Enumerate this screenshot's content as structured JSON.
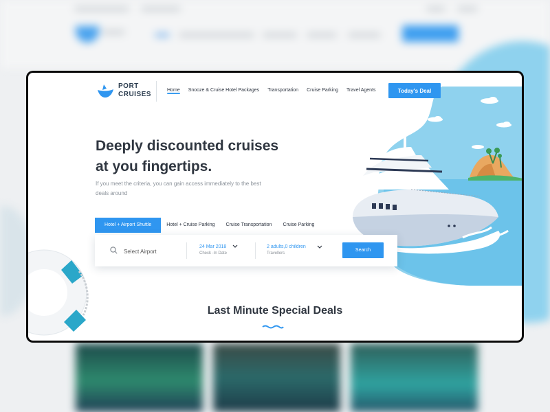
{
  "colors": {
    "accent": "#2f96f0",
    "text_dark": "#2f3640",
    "sea": "#8fd2ee"
  },
  "brand": {
    "line1": "PORT",
    "line2": "CRUISES",
    "logo_icon": "boat-icon"
  },
  "nav": {
    "items": [
      {
        "label": "Home",
        "active": true
      },
      {
        "label": "Snooze & Cruise Hotel Packages",
        "active": false
      },
      {
        "label": "Transportation",
        "active": false
      },
      {
        "label": "Cruise Parking",
        "active": false
      },
      {
        "label": "Travel Agents",
        "active": false
      }
    ],
    "cta_label": "Today's Deal"
  },
  "hero": {
    "title_line1": "Deeply discounted cruises",
    "title_line2": "at you fingertips.",
    "subtitle": "If you meet the criteria, you can gain access immediately to the best deals around"
  },
  "search": {
    "tabs": [
      {
        "label": "Hotel + Airport Shuttle",
        "active": true
      },
      {
        "label": "Hotel + Cruise Parking",
        "active": false
      },
      {
        "label": "Cruise Transportation",
        "active": false
      },
      {
        "label": "Cruise Parking",
        "active": false
      }
    ],
    "airport_placeholder": "Select Airport",
    "date_value": "24 Mar 2018",
    "date_label": "Check -In Date",
    "travellers_value": "2 adults,0 children",
    "travellers_label": "Travellers",
    "button_label": "Search"
  },
  "deals": {
    "title": "Last Minute Special Deals"
  }
}
